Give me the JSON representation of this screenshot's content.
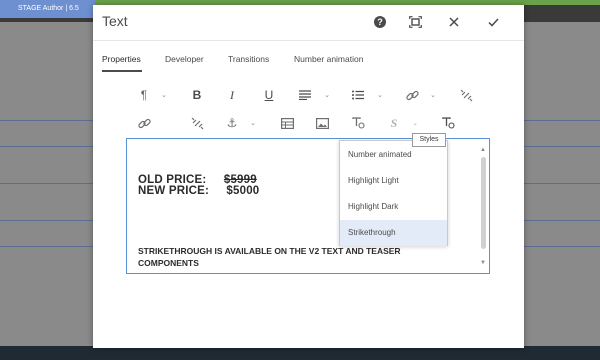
{
  "app": {
    "badge": "STAGE Author | 6.5"
  },
  "dialog": {
    "title": "Text",
    "tabs": [
      {
        "label": "Properties",
        "active": true
      },
      {
        "label": "Developer",
        "active": false
      },
      {
        "label": "Transitions",
        "active": false
      },
      {
        "label": "Number animation",
        "active": false
      }
    ]
  },
  "toolbar": {
    "row1": [
      "paragraph-format",
      "bold",
      "italic",
      "underline",
      "justify",
      "list",
      "link",
      "unlink"
    ],
    "row2": [
      "link",
      "unlink",
      "anchor",
      "table",
      "image",
      "special-character",
      "styles",
      "text-format"
    ],
    "bold_glyph": "B",
    "italic_glyph": "I",
    "underline_glyph": "U",
    "styles_glyph": "S"
  },
  "tooltip": {
    "text": "Styles"
  },
  "styles_menu": {
    "items": [
      {
        "label": "Number animated",
        "selected": false
      },
      {
        "label": "Highlight Light",
        "selected": false
      },
      {
        "label": "Highlight Dark",
        "selected": false
      },
      {
        "label": "Strikethrough",
        "selected": true
      }
    ]
  },
  "editor": {
    "old_label": "OLD PRICE:",
    "old_value": "$5999",
    "new_label": "NEW PRICE:",
    "new_value": "$5000",
    "promo": "STRIKETHROUGH IS AVAILABLE ON THE V2 TEXT AND TEASER COMPONENTS"
  },
  "colors": {
    "accent": "#5a8fd6",
    "badge": "#6e8fd0",
    "selected_item": "#e4ebf8"
  }
}
